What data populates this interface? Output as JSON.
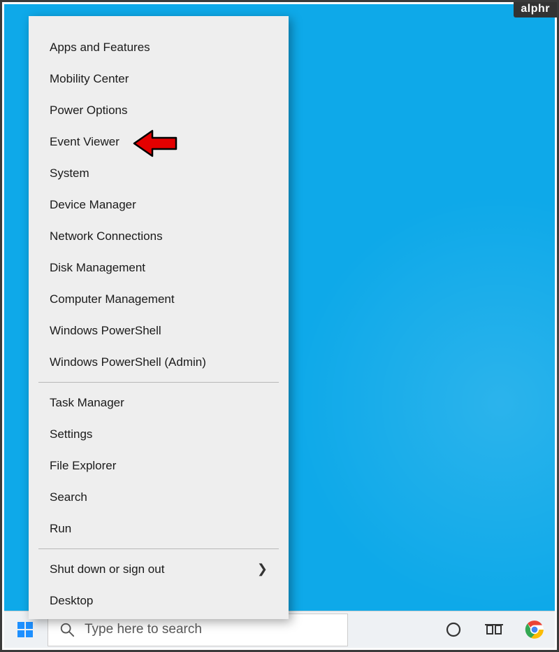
{
  "watermark": "alphr",
  "menu": {
    "groups": [
      [
        {
          "label": "Apps and Features"
        },
        {
          "label": "Mobility Center"
        },
        {
          "label": "Power Options"
        },
        {
          "label": "Event Viewer",
          "highlighted": true
        },
        {
          "label": "System"
        },
        {
          "label": "Device Manager"
        },
        {
          "label": "Network Connections"
        },
        {
          "label": "Disk Management"
        },
        {
          "label": "Computer Management"
        },
        {
          "label": "Windows PowerShell"
        },
        {
          "label": "Windows PowerShell (Admin)"
        }
      ],
      [
        {
          "label": "Task Manager"
        },
        {
          "label": "Settings"
        },
        {
          "label": "File Explorer"
        },
        {
          "label": "Search"
        },
        {
          "label": "Run"
        }
      ],
      [
        {
          "label": "Shut down or sign out",
          "submenu": true
        },
        {
          "label": "Desktop"
        }
      ]
    ]
  },
  "taskbar": {
    "search_placeholder": "Type here to search"
  }
}
